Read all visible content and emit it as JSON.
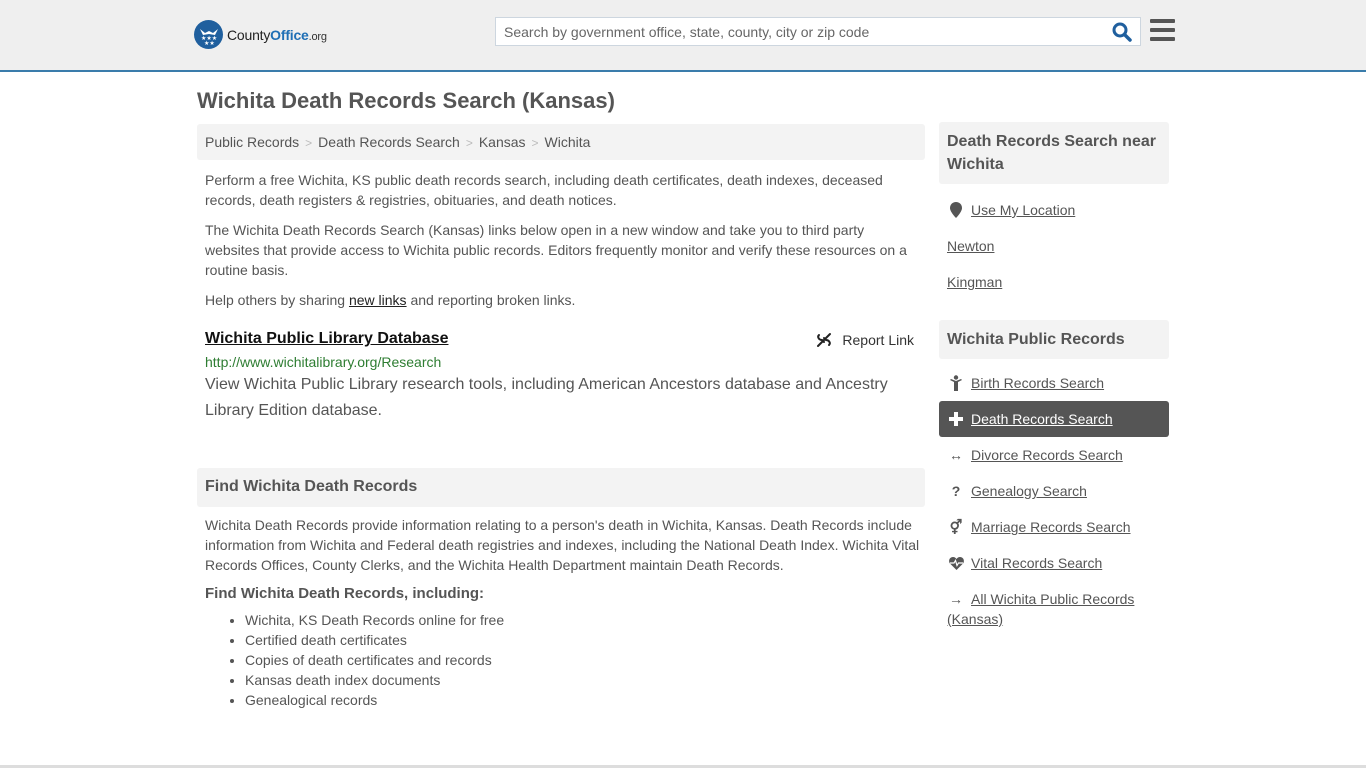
{
  "header": {
    "logo": {
      "county": "County",
      "office": "Office",
      "org": ".org"
    },
    "search_placeholder": "Search by government office, state, county, city or zip code",
    "search_value": "",
    "accent_color": "#3a7cab"
  },
  "page_title": "Wichita Death Records Search (Kansas)",
  "breadcrumb": [
    {
      "label": "Public Records"
    },
    {
      "label": "Death Records Search"
    },
    {
      "label": "Kansas"
    },
    {
      "label": "Wichita"
    }
  ],
  "breadcrumb_separator": ">",
  "intro": {
    "p1": "Perform a free Wichita, KS public death records search, including death certificates, death indexes, deceased records, death registers & registries, obituaries, and death notices.",
    "p2": "The Wichita Death Records Search (Kansas) links below open in a new window and take you to third party websites that provide access to Wichita public records. Editors frequently monitor and verify these resources on a routine basis.",
    "p3_before": "Help others by sharing ",
    "p3_link": "new links",
    "p3_after": " and reporting broken links."
  },
  "resource": {
    "title": "Wichita Public Library Database",
    "report_label": "Report Link",
    "url": "http://www.wichitalibrary.org/Research",
    "description": "View Wichita Public Library research tools, including American Ancestors database and Ancestry Library Edition database."
  },
  "find_section": {
    "heading": "Find Wichita Death Records",
    "body": "Wichita Death Records provide information relating to a person's death in Wichita, Kansas. Death Records include information from Wichita and Federal death registries and indexes, including the National Death Index. Wichita Vital Records Offices, County Clerks, and the Wichita Health Department maintain Death Records.",
    "subheading": "Find Wichita Death Records, including:",
    "items": [
      "Wichita, KS Death Records online for free",
      "Certified death certificates",
      "Copies of death certificates and records",
      "Kansas death index documents",
      "Genealogical records"
    ]
  },
  "sidebar": {
    "nearby": {
      "heading": "Death Records Search near Wichita",
      "use_location": "Use My Location",
      "cities": [
        "Newton",
        "Kingman"
      ]
    },
    "public_records": {
      "heading": "Wichita Public Records",
      "items": [
        {
          "label": "Birth Records Search",
          "icon": "child-icon",
          "active": false
        },
        {
          "label": "Death Records Search",
          "icon": "plus-icon",
          "active": true
        },
        {
          "label": "Divorce Records Search",
          "icon": "arrows-horizontal-icon",
          "active": false
        },
        {
          "label": "Genealogy Search",
          "icon": "question-icon",
          "active": false
        },
        {
          "label": "Marriage Records Search",
          "icon": "venus-mars-icon",
          "active": false
        },
        {
          "label": "Vital Records Search",
          "icon": "heartbeat-icon",
          "active": false
        },
        {
          "label": "All Wichita Public Records (Kansas)",
          "icon": "arrow-right-icon",
          "active": false
        }
      ]
    }
  }
}
